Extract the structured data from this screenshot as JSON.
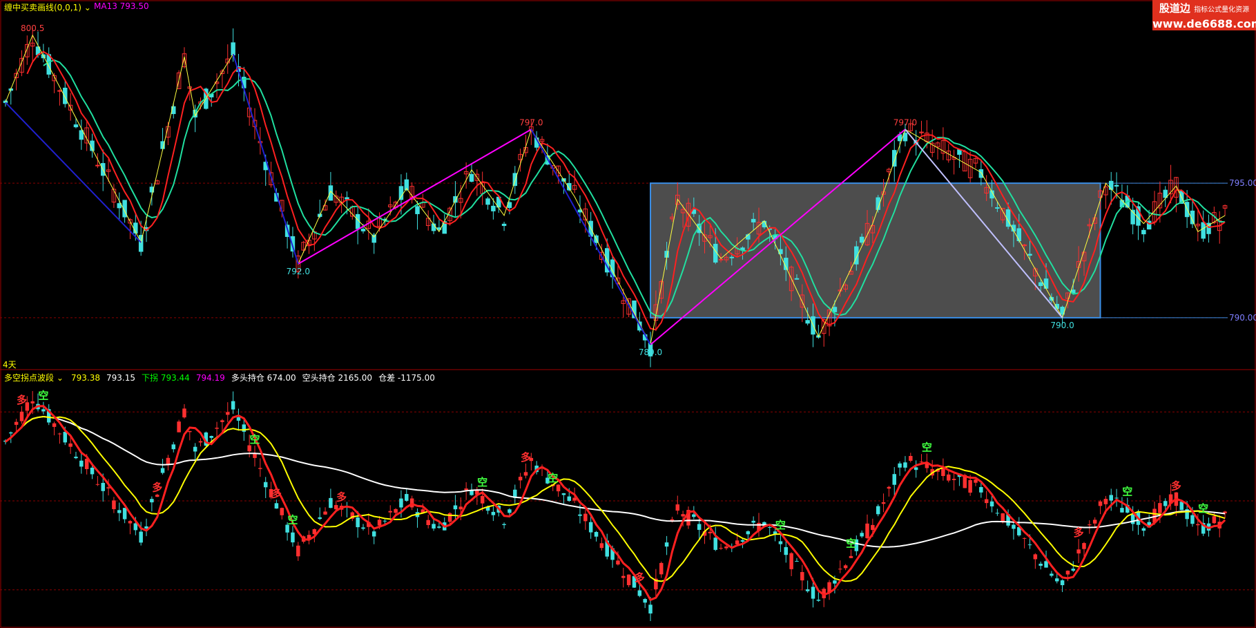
{
  "header": {
    "top_indicator": "缠中买卖画线(0,0,1)",
    "top_ma": "MA13 793.50",
    "period": "4天",
    "bottom_indicator": "多空拐点波段",
    "bottom_values": [
      {
        "text": "793.38",
        "color": "#ffff00"
      },
      {
        "text": "793.15",
        "color": "#ffffff"
      },
      {
        "text": "下拐 793.44",
        "color": "#00ff00"
      },
      {
        "text": "794.19",
        "color": "#ff00ff"
      },
      {
        "text": "多头持仓 674.00",
        "color": "#ffffff"
      },
      {
        "text": "空头持仓 2165.00",
        "color": "#ffffff"
      },
      {
        "text": "仓差 -1175.00",
        "color": "#ffffff"
      }
    ]
  },
  "logo": {
    "line1": "股道边",
    "line1_small": "指标公式量化资源",
    "line2": "www.de6688.com"
  },
  "colors": {
    "up_bar": "#ff3030",
    "down_bar": "#40e0e0",
    "ma": "#ff2020",
    "ma_slow": "#20e0a0",
    "zigzag": "#ffff40",
    "trend_line": "#ff00ff",
    "box_fill": "#555555",
    "box_border": "#3a8ee6",
    "grid": "#8b0000",
    "axis": "#7f7fff"
  },
  "chart_data": [
    {
      "type": "candlestick",
      "panel": "main",
      "y_axis_labels": [
        "795.00",
        "790.00"
      ],
      "ylim": [
        788.2,
        801.5
      ],
      "peak_labels": [
        {
          "bar": 5,
          "value": 800.5,
          "label": "800.5"
        },
        {
          "bar": 54,
          "value": 792.0,
          "label": "792.0"
        },
        {
          "bar": 97,
          "value": 797.0,
          "label": "797.0"
        },
        {
          "bar": 119,
          "value": 789.0,
          "label": "789.0"
        },
        {
          "bar": 166,
          "value": 797.0,
          "label": "797.0"
        },
        {
          "bar": 195,
          "value": 790.0,
          "label": "790.0"
        }
      ],
      "consolidation_box": {
        "from_bar": 119,
        "to_bar": 202,
        "low": 790.0,
        "high": 795.0
      },
      "trend_lines": [
        {
          "from": [
            54,
            792.0
          ],
          "to": [
            97,
            797.0
          ],
          "color": "#ff00ff"
        },
        {
          "from": [
            119,
            789.0
          ],
          "to": [
            166,
            797.0
          ],
          "color": "#ff00ff"
        },
        {
          "from": [
            0,
            798.0
          ],
          "to": [
            25,
            792.8
          ],
          "color": "#2020d0"
        },
        {
          "from": [
            42,
            799.8
          ],
          "to": [
            54,
            792.0
          ],
          "color": "#2020d0"
        },
        {
          "from": [
            97,
            797.0
          ],
          "to": [
            119,
            789.0
          ],
          "color": "#2020d0"
        },
        {
          "from": [
            166,
            797.0
          ],
          "to": [
            195,
            790.0
          ],
          "color": "#c0c0ff"
        }
      ]
    },
    {
      "type": "candlestick",
      "panel": "sub",
      "ylim": [
        -1.0,
        1.0
      ],
      "signals": [
        {
          "bar": 3,
          "text": "多",
          "color": "#ff3030"
        },
        {
          "bar": 7,
          "text": "空",
          "color": "#40ff40"
        },
        {
          "bar": 46,
          "text": "空",
          "color": "#40ff40"
        },
        {
          "bar": 50,
          "text": "多",
          "color": "#ff3030"
        },
        {
          "bar": 53,
          "text": "空",
          "color": "#40ff40"
        },
        {
          "bar": 28,
          "text": "多",
          "color": "#ff3030"
        },
        {
          "bar": 62,
          "text": "多",
          "color": "#ff3030"
        },
        {
          "bar": 88,
          "text": "空",
          "color": "#40ff40"
        },
        {
          "bar": 96,
          "text": "多",
          "color": "#ff3030"
        },
        {
          "bar": 101,
          "text": "空",
          "color": "#40ff40"
        },
        {
          "bar": 117,
          "text": "多",
          "color": "#ff3030"
        },
        {
          "bar": 143,
          "text": "空",
          "color": "#40ff40"
        },
        {
          "bar": 156,
          "text": "空",
          "color": "#40ff40"
        },
        {
          "bar": 170,
          "text": "空",
          "color": "#40ff40"
        },
        {
          "bar": 198,
          "text": "多",
          "color": "#ff3030"
        },
        {
          "bar": 207,
          "text": "空",
          "color": "#40ff40"
        },
        {
          "bar": 216,
          "text": "多",
          "color": "#ff3030"
        },
        {
          "bar": 221,
          "text": "空",
          "color": "#40ff40"
        }
      ]
    }
  ]
}
